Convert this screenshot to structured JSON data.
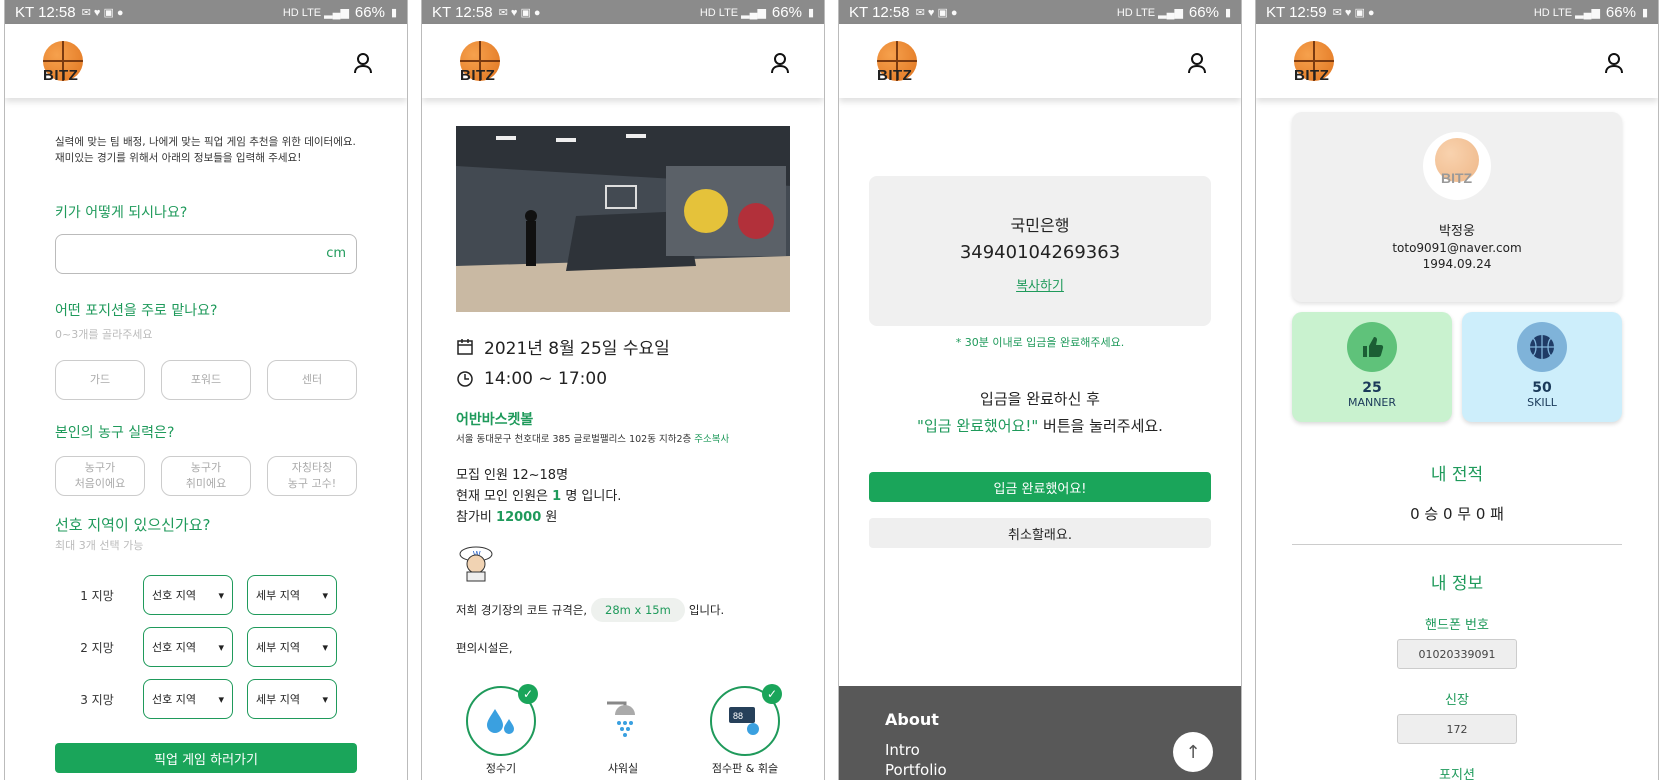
{
  "status_bars": [
    {
      "left": "KT 12:58",
      "battery": "66%"
    },
    {
      "left": "KT 12:58",
      "battery": "66%"
    },
    {
      "left": "KT 12:58",
      "battery": "66%"
    },
    {
      "left": "KT 12:59",
      "battery": "66%"
    }
  ],
  "brand": {
    "logo_text": "BITZ"
  },
  "colors": {
    "accent": "#1aa55a",
    "footer": "#585858",
    "manner": "#c9f2cf",
    "skill": "#cdeefb"
  },
  "survey": {
    "intro_1": "실력에 맞는 팀 배정, 나에게 맞는 픽업 게임 추천을 위한 데이터에요.",
    "intro_2": "재미있는 경기를 위해서 아래의 정보들을 입력해 주세요!",
    "height_question": "키가 어떻게 되시나요?",
    "height_unit": "cm",
    "position_question": "어떤 포지션을 주로 맡나요?",
    "position_hint": "0~3개를 골라주세요",
    "positions": [
      "가드",
      "포워드",
      "센터"
    ],
    "skill_question": "본인의 농구 실력은?",
    "skills": [
      {
        "line1": "농구가",
        "line2": "처음이에요"
      },
      {
        "line1": "농구가",
        "line2": "취미에요"
      },
      {
        "line1": "자칭타칭",
        "line2": "농구 고수!"
      }
    ],
    "region_question": "선호 지역이 있으신가요?",
    "region_hint": "최대 3개 선택 가능",
    "preferences": [
      {
        "rank": "1 지망",
        "region": "선호 지역",
        "detail": "세부 지역"
      },
      {
        "rank": "2 지망",
        "region": "선호 지역",
        "detail": "세부 지역"
      },
      {
        "rank": "3 지망",
        "region": "선호 지역",
        "detail": "세부 지역"
      }
    ],
    "submit": "픽업 게임 하러가기"
  },
  "game": {
    "date": "2021년 8월 25일 수요일",
    "time": "14:00 ~ 17:00",
    "venue": "어반바스켓볼",
    "address": "서울 동대문구 천호대로 385 글로벌팰리스 102동 지하2층",
    "copy_address": "주소복사",
    "recruit": "모집 인원 12~18명",
    "current_prefix": "현재 모인 인원은",
    "current_count": "1",
    "current_suffix": "명 입니다.",
    "fee_prefix": "참가비",
    "fee": "12000",
    "fee_suffix": "원",
    "court_prefix": "저희 경기장의 코트 규격은,",
    "court_size": "28m x 15m",
    "court_suffix": "입니다.",
    "facilities_intro": "편의시설은,",
    "facilities": [
      "정수기",
      "샤워실",
      "점수판 & 휘슬"
    ]
  },
  "payment": {
    "bank": "국민은행",
    "account": "34940104269363",
    "copy": "복사하기",
    "notice": "* 30분 이내로 입금을 완료해주세요.",
    "instruction_1": "입금을 완료하신 후",
    "instruction_quote": "\"입금 완료했어요!\"",
    "instruction_2": "버튼을 눌러주세요.",
    "confirm": "입금 완료했어요!",
    "cancel": "취소할래요.",
    "footer_title": "About",
    "footer_links": [
      "Intro",
      "Portfolio"
    ]
  },
  "profile": {
    "name": "박정웅",
    "email": "toto9091@naver.com",
    "birth": "1994.09.24",
    "manner_value": "25",
    "manner_label": "MANNER",
    "skill_value": "50",
    "skill_label": "SKILL",
    "record_title": "내 전적",
    "record": "0 승 0 무 0 패",
    "info_title": "내 정보",
    "phone_label": "핸드폰 번호",
    "phone": "01020339091",
    "height_label": "신장",
    "height": "172",
    "position_label": "포지션"
  }
}
